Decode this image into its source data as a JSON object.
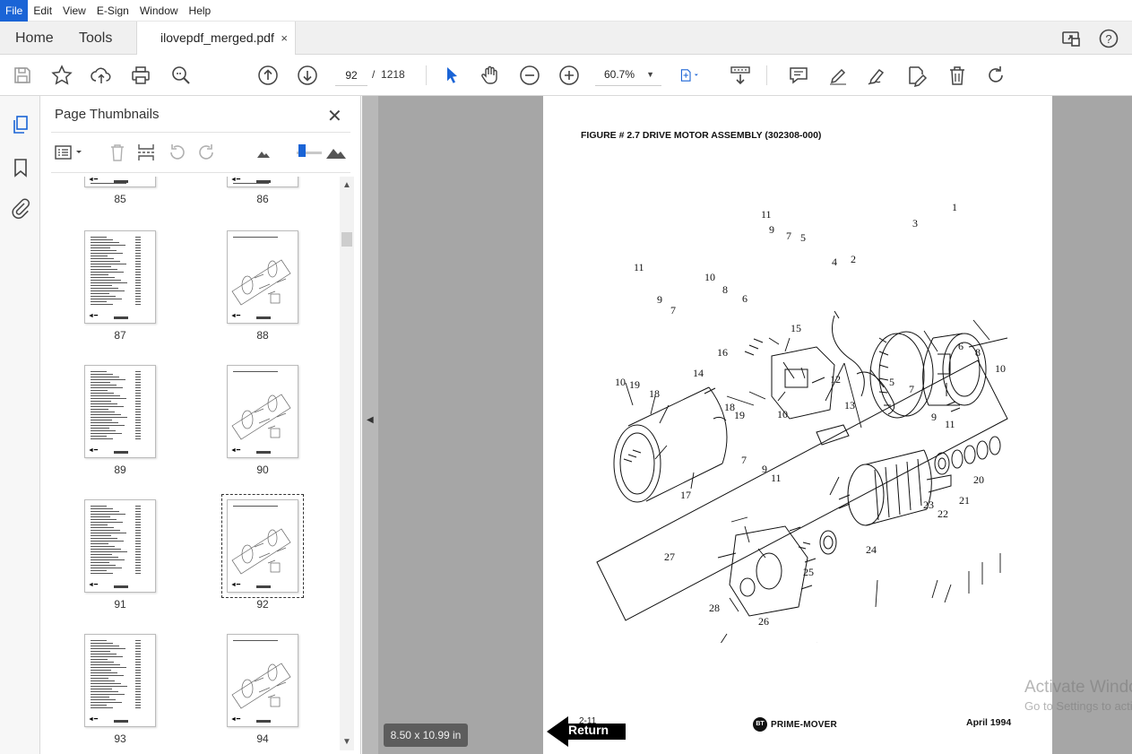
{
  "menu": [
    "File",
    "Edit",
    "View",
    "E-Sign",
    "Window",
    "Help"
  ],
  "nav": {
    "home": "Home",
    "tools": "Tools"
  },
  "document_tab": {
    "title": "ilovepdf_merged.pdf",
    "close": "×"
  },
  "toolbar": {
    "current_page": "92",
    "total_pages": "1218",
    "page_separator": "/",
    "zoom": "60.7%",
    "icons": [
      "save-icon",
      "star-icon",
      "upload-cloud-icon",
      "print-icon",
      "zoom-search-icon",
      "page-up-icon",
      "page-down-icon",
      "select-pointer-icon",
      "hand-pan-icon",
      "zoom-out-icon",
      "zoom-in-icon",
      "fit-page-icon",
      "scroll-mode-icon",
      "comment-icon",
      "highlight-icon",
      "sign-icon",
      "edit-pdf-icon",
      "delete-icon",
      "rotate-icon"
    ]
  },
  "panel": {
    "title": "Page Thumbnails",
    "close": "✕",
    "thumbnails": [
      {
        "page": "85",
        "kind": "top"
      },
      {
        "page": "86",
        "kind": "top"
      },
      {
        "page": "87",
        "kind": "list"
      },
      {
        "page": "88",
        "kind": "diagram"
      },
      {
        "page": "89",
        "kind": "list"
      },
      {
        "page": "90",
        "kind": "diagram"
      },
      {
        "page": "91",
        "kind": "list"
      },
      {
        "page": "92",
        "kind": "diagram",
        "selected": true
      },
      {
        "page": "93",
        "kind": "list"
      },
      {
        "page": "94",
        "kind": "diagram"
      }
    ]
  },
  "page": {
    "figure_title": "FIGURE # 2.7  DRIVE MOTOR ASSEMBLY (302308-000)",
    "page_number": "2-11",
    "return_label": "Return",
    "brand": "PRIME-MOVER",
    "brand_logo": "BT",
    "date": "April 1994",
    "callouts": [
      "1",
      "2",
      "3",
      "4",
      "5",
      "6",
      "7",
      "8",
      "9",
      "10",
      "11",
      "12",
      "13",
      "14",
      "15",
      "16",
      "17",
      "18",
      "19",
      "20",
      "21",
      "22",
      "23",
      "24",
      "25",
      "26",
      "27",
      "28"
    ]
  },
  "status": {
    "page_size": "8.50 x 10.99 in"
  },
  "watermark": {
    "line1": "Activate Windows",
    "line2": "Go to Settings to activate Windows."
  },
  "colors": {
    "accent": "#1a64d6",
    "doc_bg": "#a6a6a6",
    "panel_bg": "#ffffff"
  }
}
